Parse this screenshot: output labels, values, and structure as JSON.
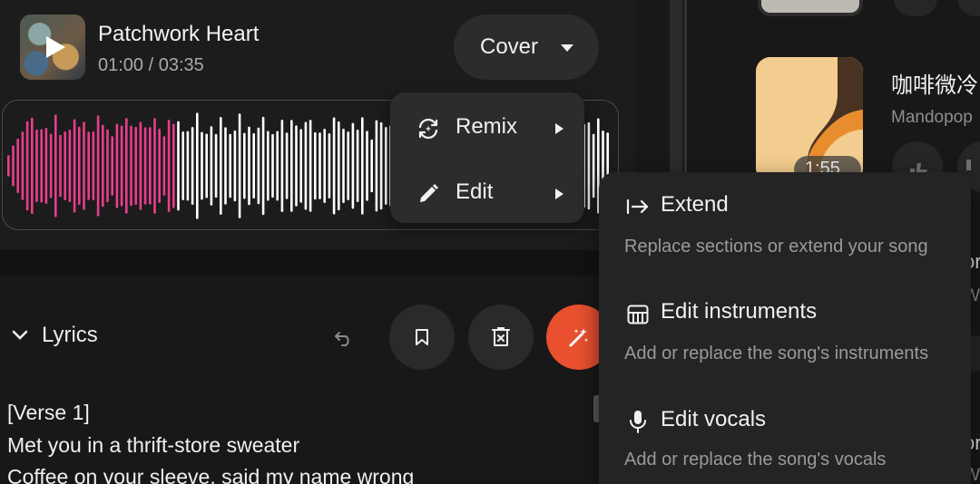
{
  "player": {
    "song_title": "Patchwork Heart",
    "time": "01:00 / 03:35",
    "progress": 0.279,
    "cover_button_label": "Cover"
  },
  "colors": {
    "played": "#e83e8c",
    "unplayed": "#ffffff",
    "magic_button": "#e8502f",
    "menu_bg": "#2c2c2c",
    "submenu_bg": "#242424"
  },
  "lyrics": {
    "toggle_label": "Lyrics",
    "lines": [
      "[Verse 1]",
      "Met you in a thrift-store sweater",
      "Coffee on your sleeve, said my name wrong"
    ]
  },
  "toolbar": {
    "icons": [
      "undo-icon",
      "bookmark-icon",
      "delete-icon",
      "magic-wand-icon"
    ]
  },
  "context_menu": {
    "items": [
      {
        "label": "Remix",
        "icon": "remix-icon"
      },
      {
        "label": "Edit",
        "icon": "pencil-icon"
      }
    ]
  },
  "submenu": {
    "items": [
      {
        "title": "Extend",
        "description": "Replace sections or extend your song",
        "icon": "extend-arrow-icon"
      },
      {
        "title": "Edit instruments",
        "description": "Add or replace the song's instruments",
        "icon": "piano-icon"
      },
      {
        "title": "Edit vocals",
        "description": "Add or replace the song's vocals",
        "icon": "microphone-icon"
      }
    ]
  },
  "side_list": {
    "track_title": "咖啡微冷",
    "track_genre": "Mandopop",
    "track_duration": "1:55",
    "peek_texts": [
      "or",
      "Wa",
      "or",
      "Wa"
    ]
  }
}
